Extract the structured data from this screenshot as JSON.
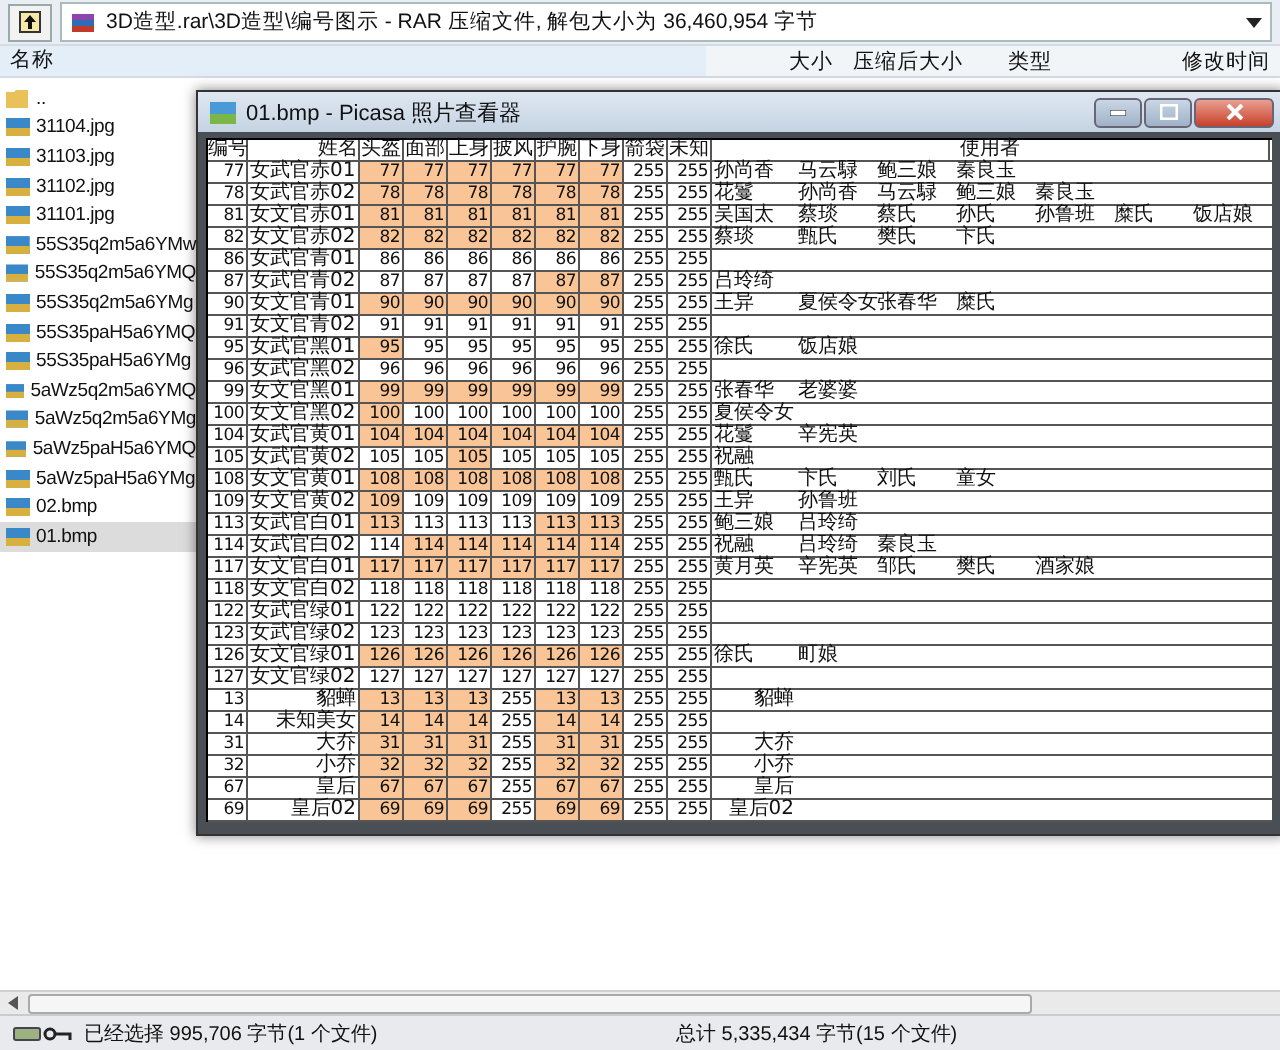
{
  "address_bar": {
    "path": "3D造型.rar\\3D造型\\编号图示 - RAR 压缩文件, 解包大小为 36,460,954 字节"
  },
  "file_columns": [
    "名称",
    "大小",
    "压缩后大小",
    "类型",
    "修改时间"
  ],
  "files": [
    {
      "name": "..",
      "kind": "folder",
      "selected": false
    },
    {
      "name": "31104.jpg",
      "kind": "image",
      "selected": false
    },
    {
      "name": "31103.jpg",
      "kind": "image",
      "selected": false
    },
    {
      "name": "31102.jpg",
      "kind": "image",
      "selected": false
    },
    {
      "name": "31101.jpg",
      "kind": "image",
      "selected": false
    },
    {
      "name": "55S35q2m5a6YMw",
      "kind": "image",
      "selected": false
    },
    {
      "name": "55S35q2m5a6YMQ",
      "kind": "image",
      "selected": false
    },
    {
      "name": "55S35q2m5a6YMg",
      "kind": "image",
      "selected": false
    },
    {
      "name": "55S35paH5a6YMQ",
      "kind": "image",
      "selected": false
    },
    {
      "name": "55S35paH5a6YMg",
      "kind": "image",
      "selected": false
    },
    {
      "name": "5aWz5q2m5a6YMQ",
      "kind": "image",
      "selected": false
    },
    {
      "name": "5aWz5q2m5a6YMg",
      "kind": "image",
      "selected": false
    },
    {
      "name": "5aWz5paH5a6YMQ",
      "kind": "image",
      "selected": false
    },
    {
      "name": "5aWz5paH5a6YMg",
      "kind": "image",
      "selected": false
    },
    {
      "name": "02.bmp",
      "kind": "image",
      "selected": false
    },
    {
      "name": "01.bmp",
      "kind": "image",
      "selected": true
    }
  ],
  "viewer": {
    "title": "01.bmp - Picasa 照片查看器",
    "table": {
      "columns": [
        "编号",
        "姓名",
        "头盔",
        "面部",
        "上身",
        "披风",
        "护腕",
        "下身",
        "箭袋",
        "未知",
        "使用者"
      ],
      "rows": [
        {
          "id": "77",
          "name": "女武官赤01",
          "kind": "officer",
          "values": [
            "77",
            "77",
            "77",
            "77",
            "77",
            "77",
            "255",
            "255"
          ],
          "highlighted": [
            true,
            true,
            true,
            true,
            true,
            true,
            false,
            false
          ],
          "users": [
            "孙尚香",
            "马云騄",
            "鲍三娘",
            "秦良玉"
          ]
        },
        {
          "id": "78",
          "name": "女武官赤02",
          "kind": "officer",
          "values": [
            "78",
            "78",
            "78",
            "78",
            "78",
            "78",
            "255",
            "255"
          ],
          "highlighted": [
            true,
            true,
            true,
            true,
            true,
            true,
            false,
            false
          ],
          "users": [
            "花鬘",
            "孙尚香",
            "马云騄",
            "鲍三娘",
            "秦良玉"
          ]
        },
        {
          "id": "81",
          "name": "女文官赤01",
          "kind": "officer",
          "values": [
            "81",
            "81",
            "81",
            "81",
            "81",
            "81",
            "255",
            "255"
          ],
          "highlighted": [
            true,
            true,
            true,
            true,
            true,
            true,
            false,
            false
          ],
          "users": [
            "吴国太",
            "蔡琰",
            "蔡氏",
            "孙氏",
            "孙鲁班",
            "糜氏",
            "饭店娘"
          ]
        },
        {
          "id": "82",
          "name": "女文官赤02",
          "kind": "officer",
          "values": [
            "82",
            "82",
            "82",
            "82",
            "82",
            "82",
            "255",
            "255"
          ],
          "highlighted": [
            true,
            true,
            true,
            true,
            true,
            true,
            false,
            false
          ],
          "users": [
            "蔡琰",
            "甄氏",
            "樊氏",
            "卞氏"
          ]
        },
        {
          "id": "86",
          "name": "女武官青01",
          "kind": "officer",
          "values": [
            "86",
            "86",
            "86",
            "86",
            "86",
            "86",
            "255",
            "255"
          ],
          "highlighted": [
            false,
            false,
            false,
            false,
            false,
            false,
            false,
            false
          ],
          "users": []
        },
        {
          "id": "87",
          "name": "女武官青02",
          "kind": "officer",
          "values": [
            "87",
            "87",
            "87",
            "87",
            "87",
            "87",
            "255",
            "255"
          ],
          "highlighted": [
            false,
            false,
            false,
            false,
            true,
            true,
            false,
            false
          ],
          "users": [
            "吕玲绮"
          ]
        },
        {
          "id": "90",
          "name": "女文官青01",
          "kind": "officer",
          "values": [
            "90",
            "90",
            "90",
            "90",
            "90",
            "90",
            "255",
            "255"
          ],
          "highlighted": [
            true,
            true,
            true,
            true,
            true,
            true,
            false,
            false
          ],
          "users": [
            "王异",
            "夏侯令女",
            "张春华",
            "糜氏"
          ]
        },
        {
          "id": "91",
          "name": "女文官青02",
          "kind": "officer",
          "values": [
            "91",
            "91",
            "91",
            "91",
            "91",
            "91",
            "255",
            "255"
          ],
          "highlighted": [
            false,
            false,
            false,
            false,
            false,
            false,
            false,
            false
          ],
          "users": []
        },
        {
          "id": "95",
          "name": "女武官黑01",
          "kind": "officer",
          "values": [
            "95",
            "95",
            "95",
            "95",
            "95",
            "95",
            "255",
            "255"
          ],
          "highlighted": [
            true,
            false,
            false,
            false,
            false,
            false,
            false,
            false
          ],
          "users": [
            "徐氏",
            "饭店娘"
          ]
        },
        {
          "id": "96",
          "name": "女武官黑02",
          "kind": "officer",
          "values": [
            "96",
            "96",
            "96",
            "96",
            "96",
            "96",
            "255",
            "255"
          ],
          "highlighted": [
            false,
            false,
            false,
            false,
            false,
            false,
            false,
            false
          ],
          "users": []
        },
        {
          "id": "99",
          "name": "女文官黑01",
          "kind": "officer",
          "values": [
            "99",
            "99",
            "99",
            "99",
            "99",
            "99",
            "255",
            "255"
          ],
          "highlighted": [
            true,
            true,
            true,
            true,
            true,
            true,
            false,
            false
          ],
          "users": [
            "张春华",
            "老婆婆"
          ]
        },
        {
          "id": "100",
          "name": "女文官黑02",
          "kind": "officer",
          "values": [
            "100",
            "100",
            "100",
            "100",
            "100",
            "100",
            "255",
            "255"
          ],
          "highlighted": [
            true,
            false,
            false,
            false,
            false,
            false,
            false,
            false
          ],
          "users": [
            "夏侯令女"
          ]
        },
        {
          "id": "104",
          "name": "女武官黄01",
          "kind": "officer",
          "values": [
            "104",
            "104",
            "104",
            "104",
            "104",
            "104",
            "255",
            "255"
          ],
          "highlighted": [
            true,
            true,
            true,
            true,
            true,
            true,
            false,
            false
          ],
          "users": [
            "花鬘",
            "辛宪英"
          ]
        },
        {
          "id": "105",
          "name": "女武官黄02",
          "kind": "officer",
          "values": [
            "105",
            "105",
            "105",
            "105",
            "105",
            "105",
            "255",
            "255"
          ],
          "highlighted": [
            false,
            false,
            true,
            false,
            false,
            false,
            false,
            false
          ],
          "users": [
            "祝融"
          ]
        },
        {
          "id": "108",
          "name": "女文官黄01",
          "kind": "officer",
          "values": [
            "108",
            "108",
            "108",
            "108",
            "108",
            "108",
            "255",
            "255"
          ],
          "highlighted": [
            true,
            true,
            true,
            true,
            true,
            true,
            false,
            false
          ],
          "users": [
            "甄氏",
            "卞氏",
            "刘氏",
            "童女"
          ]
        },
        {
          "id": "109",
          "name": "女文官黄02",
          "kind": "officer",
          "values": [
            "109",
            "109",
            "109",
            "109",
            "109",
            "109",
            "255",
            "255"
          ],
          "highlighted": [
            true,
            false,
            false,
            false,
            false,
            false,
            false,
            false
          ],
          "users": [
            "王异",
            "孙鲁班"
          ]
        },
        {
          "id": "113",
          "name": "女武官白01",
          "kind": "officer",
          "values": [
            "113",
            "113",
            "113",
            "113",
            "113",
            "113",
            "255",
            "255"
          ],
          "highlighted": [
            true,
            false,
            false,
            false,
            true,
            true,
            false,
            false
          ],
          "users": [
            "鲍三娘",
            "吕玲绮"
          ]
        },
        {
          "id": "114",
          "name": "女武官白02",
          "kind": "officer",
          "values": [
            "114",
            "114",
            "114",
            "114",
            "114",
            "114",
            "255",
            "255"
          ],
          "highlighted": [
            false,
            true,
            true,
            true,
            true,
            true,
            false,
            false
          ],
          "users": [
            "祝融",
            "吕玲绮",
            "秦良玉"
          ]
        },
        {
          "id": "117",
          "name": "女文官白01",
          "kind": "officer",
          "values": [
            "117",
            "117",
            "117",
            "117",
            "117",
            "117",
            "255",
            "255"
          ],
          "highlighted": [
            true,
            true,
            true,
            true,
            true,
            true,
            false,
            false
          ],
          "users": [
            "黄月英",
            "辛宪英",
            "邹氏",
            "樊氏",
            "酒家娘"
          ]
        },
        {
          "id": "118",
          "name": "女文官白02",
          "kind": "officer",
          "values": [
            "118",
            "118",
            "118",
            "118",
            "118",
            "118",
            "255",
            "255"
          ],
          "highlighted": [
            false,
            false,
            false,
            false,
            false,
            false,
            false,
            false
          ],
          "users": []
        },
        {
          "id": "122",
          "name": "女武官绿01",
          "kind": "officer",
          "values": [
            "122",
            "122",
            "122",
            "122",
            "122",
            "122",
            "255",
            "255"
          ],
          "highlighted": [
            false,
            false,
            false,
            false,
            false,
            false,
            false,
            false
          ],
          "users": []
        },
        {
          "id": "123",
          "name": "女武官绿02",
          "kind": "officer",
          "values": [
            "123",
            "123",
            "123",
            "123",
            "123",
            "123",
            "255",
            "255"
          ],
          "highlighted": [
            false,
            false,
            false,
            false,
            false,
            false,
            false,
            false
          ],
          "users": []
        },
        {
          "id": "126",
          "name": "女文官绿01",
          "kind": "officer",
          "values": [
            "126",
            "126",
            "126",
            "126",
            "126",
            "126",
            "255",
            "255"
          ],
          "highlighted": [
            true,
            true,
            true,
            true,
            true,
            true,
            false,
            false
          ],
          "users": [
            "徐氏",
            "町娘"
          ]
        },
        {
          "id": "127",
          "name": "女文官绿02",
          "kind": "officer",
          "values": [
            "127",
            "127",
            "127",
            "127",
            "127",
            "127",
            "255",
            "255"
          ],
          "highlighted": [
            false,
            false,
            false,
            false,
            false,
            false,
            false,
            false
          ],
          "users": []
        },
        {
          "id": "13",
          "name": "貂蝉",
          "kind": "named",
          "values": [
            "13",
            "13",
            "13",
            "255",
            "13",
            "13",
            "255",
            "255"
          ],
          "highlighted": [
            true,
            true,
            true,
            false,
            true,
            true,
            false,
            false
          ],
          "users": [
            "貂蝉"
          ]
        },
        {
          "id": "14",
          "name": "未知美女",
          "kind": "named",
          "values": [
            "14",
            "14",
            "14",
            "255",
            "14",
            "14",
            "255",
            "255"
          ],
          "highlighted": [
            true,
            true,
            true,
            false,
            true,
            true,
            false,
            false
          ],
          "users": []
        },
        {
          "id": "31",
          "name": "大乔",
          "kind": "named",
          "values": [
            "31",
            "31",
            "31",
            "255",
            "31",
            "31",
            "255",
            "255"
          ],
          "highlighted": [
            true,
            true,
            true,
            false,
            true,
            true,
            false,
            false
          ],
          "users": [
            "大乔"
          ]
        },
        {
          "id": "32",
          "name": "小乔",
          "kind": "named",
          "values": [
            "32",
            "32",
            "32",
            "255",
            "32",
            "32",
            "255",
            "255"
          ],
          "highlighted": [
            true,
            true,
            true,
            false,
            true,
            true,
            false,
            false
          ],
          "users": [
            "小乔"
          ]
        },
        {
          "id": "67",
          "name": "皇后",
          "kind": "named",
          "values": [
            "67",
            "67",
            "67",
            "255",
            "67",
            "67",
            "255",
            "255"
          ],
          "highlighted": [
            true,
            true,
            true,
            false,
            true,
            true,
            false,
            false
          ],
          "users": [
            "皇后"
          ]
        },
        {
          "id": "69",
          "name": "皇后02",
          "kind": "named",
          "values": [
            "69",
            "69",
            "69",
            "255",
            "69",
            "69",
            "255",
            "255"
          ],
          "highlighted": [
            true,
            true,
            true,
            false,
            true,
            true,
            false,
            false
          ],
          "users": [
            "皇后02"
          ]
        }
      ]
    }
  },
  "status_bar": {
    "selection": "已经选择 995,706 字节(1 个文件)",
    "total": "总计 5,335,434 字节(15 个文件)"
  }
}
